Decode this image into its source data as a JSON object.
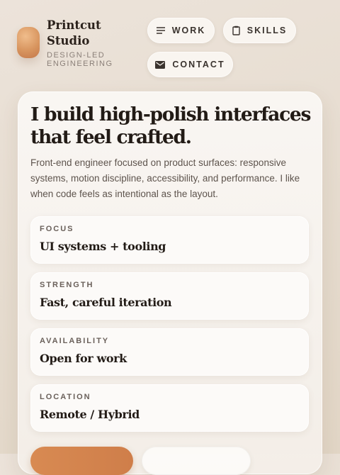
{
  "brand": {
    "name": "Printcut Studio",
    "tagline": "DESIGN-LED ENGINEERING"
  },
  "nav": {
    "items": [
      {
        "label": "WORK",
        "icon": "menu-lines-icon"
      },
      {
        "label": "SKILLS",
        "icon": "clipboard-icon"
      },
      {
        "label": "CONTACT",
        "icon": "mail-icon"
      }
    ]
  },
  "hero": {
    "headline_pre": "I build ",
    "headline_highlight": "high-polish",
    "headline_post": " interfaces that feel crafted.",
    "intro": "Front-end engineer focused on product surfaces: responsive systems, motion discipline, accessibility, and performance. I like when code feels as intentional as the layout."
  },
  "facts": [
    {
      "label": "FOCUS",
      "value": "UI systems + tooling"
    },
    {
      "label": "STRENGTH",
      "value": "Fast, careful iteration"
    },
    {
      "label": "AVAILABILITY",
      "value": "Open for work"
    },
    {
      "label": "LOCATION",
      "value": "Remote / Hybrid"
    }
  ],
  "colors": {
    "accent": "#d88a52",
    "background": "#e6dccf",
    "text": "#221b16"
  }
}
